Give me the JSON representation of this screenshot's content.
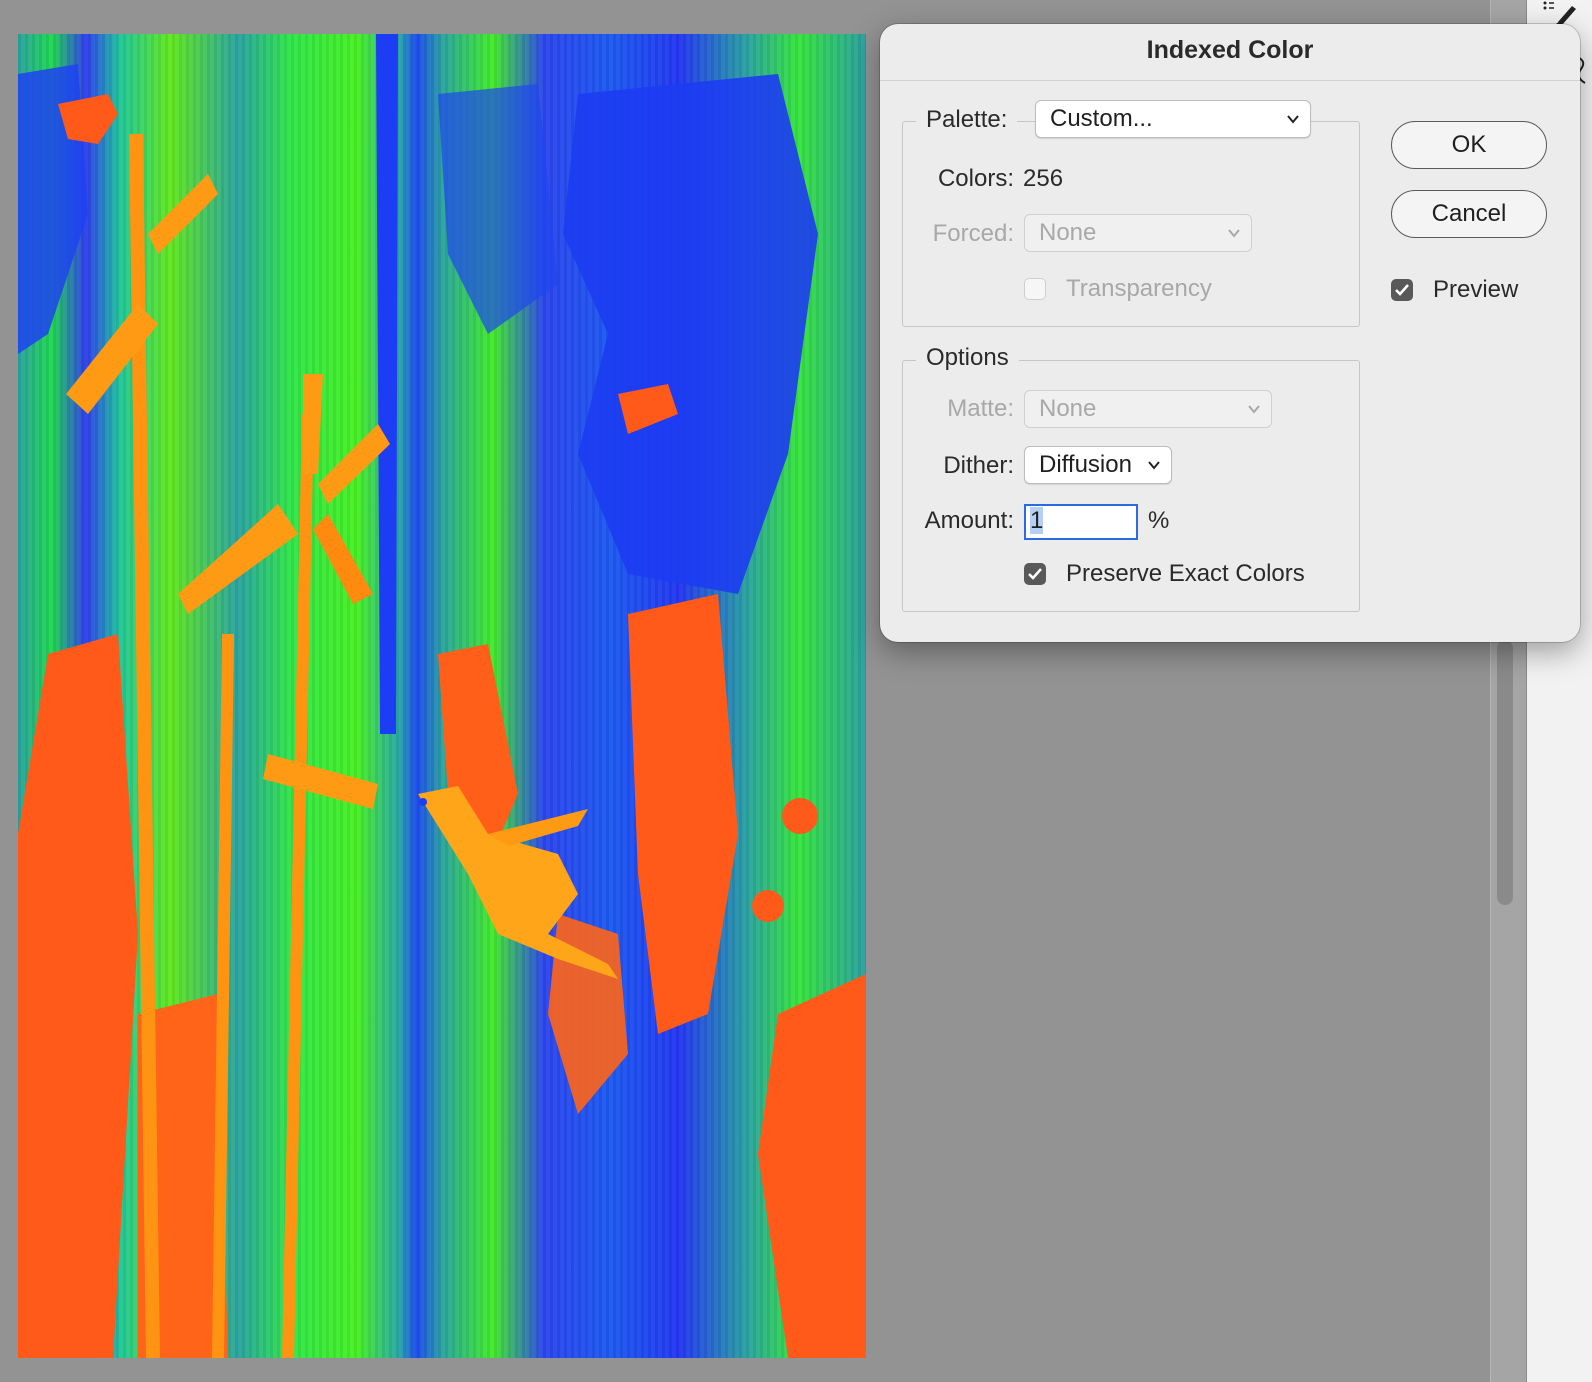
{
  "dialog": {
    "title": "Indexed Color",
    "palette": {
      "label": "Palette:",
      "value": "Custom...",
      "colors_label": "Colors:",
      "colors_value": "256",
      "forced_label": "Forced:",
      "forced_value": "None",
      "transparency_label": "Transparency",
      "transparency_checked": false
    },
    "options": {
      "legend": "Options",
      "matte_label": "Matte:",
      "matte_value": "None",
      "dither_label": "Dither:",
      "dither_value": "Diffusion",
      "amount_label": "Amount:",
      "amount_value": "1",
      "amount_unit": "%",
      "preserve_label": "Preserve Exact Colors",
      "preserve_checked": true
    },
    "buttons": {
      "ok": "OK",
      "cancel": "Cancel"
    },
    "preview": {
      "label": "Preview",
      "checked": true
    }
  },
  "colors": {
    "workspace": "#939393",
    "focus_ring": "#2a6ae2",
    "checkbox_checked": "#595959"
  }
}
